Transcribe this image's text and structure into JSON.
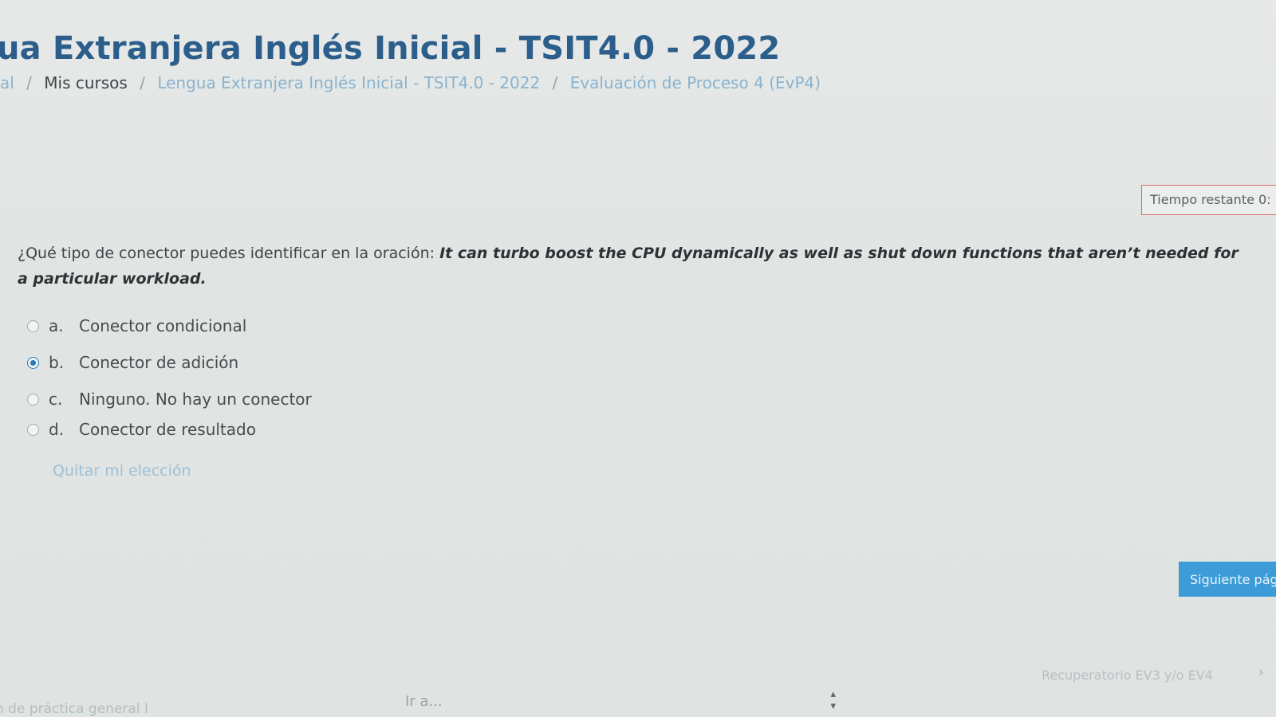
{
  "header": {
    "title": "ua Extranjera Inglés Inicial - TSIT4.0 - 2022",
    "breadcrumb": [
      {
        "label": "al",
        "style": "link"
      },
      {
        "label": "Mis cursos",
        "style": "current"
      },
      {
        "label": "Lengua Extranjera Inglés Inicial - TSIT4.0 - 2022",
        "style": "link"
      },
      {
        "label": "Evaluación de Proceso 4 (EvP4)",
        "style": "link"
      }
    ]
  },
  "timer": {
    "label": "Tiempo restante 0:"
  },
  "question": {
    "prompt": "¿Qué tipo de conector puedes identificar en la oración: ",
    "sentence": "It can turbo boost the CPU dynamically as well as shut down functions that aren’t needed for a particular workload.",
    "answers": [
      {
        "letter": "a.",
        "text": "Conector condicional",
        "selected": false
      },
      {
        "letter": "b.",
        "text": "Conector de adición",
        "selected": true
      },
      {
        "letter": "c.",
        "text": "Ninguno. No hay un conector",
        "selected": false
      },
      {
        "letter": "d.",
        "text": "Conector de resultado",
        "selected": false
      }
    ],
    "clear_label": "Quitar mi elección"
  },
  "navigation": {
    "next_button_label": "Siguiente pág",
    "prev_activity": "n de práctica general I",
    "jump_label": "Ir a...",
    "next_activity": "Recuperatorio EV3 y/o EV4",
    "next_arrow": "›"
  },
  "colors": {
    "title": "#2c5e8c",
    "accent_button": "#3d9cd8",
    "timer_border": "#d66a6a",
    "radio_selected": "#2a75b8"
  }
}
